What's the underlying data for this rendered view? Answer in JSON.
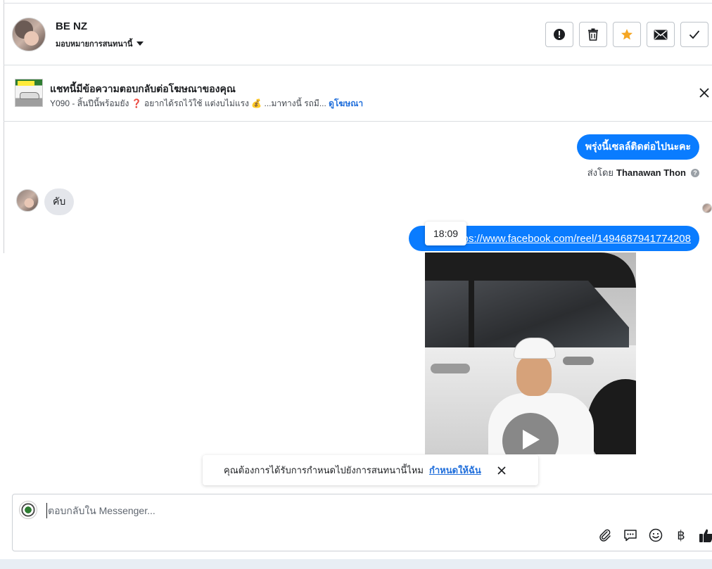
{
  "header": {
    "contact_name": "BE NZ",
    "assign_label": "มอบหมายการสนทนานี้",
    "actions": [
      {
        "icon": "alert-icon",
        "label": "Spam"
      },
      {
        "icon": "trash-icon",
        "label": "Delete"
      },
      {
        "icon": "star-icon",
        "label": "Star",
        "color": "#f5a623"
      },
      {
        "icon": "mail-icon",
        "label": "Mark unread"
      },
      {
        "icon": "check-icon",
        "label": "Done"
      }
    ]
  },
  "ad_banner": {
    "title": "แชทนี้มีข้อความตอบกลับต่อโฆษณาของคุณ",
    "subtitle": "Y090 - สิ้นปีนี้พร้อมยัง ❓ อยากได้รถไว้ใช้ แต่งบไม่แรง 💰 ...มาทางนี้ รถมื...",
    "link": "ดูโฆษณา"
  },
  "conversation": {
    "outgoing_1": "พรุ่งนี้เซลล์ติดต่อไปนะคะ",
    "sent_by_prefix": "ส่งโดย",
    "sent_by_name": "Thanawan Thon",
    "help_mark": "?",
    "incoming_1": "คับ",
    "outgoing_2_link": "https://www.facebook.com/reel/1494687941774208",
    "timestamp_tooltip": "18:09"
  },
  "schedule_prompt": {
    "text": "คุณต้องการได้รับการกำหนดไปยังการสนทนานี้ไหม",
    "link": "กำหนดให้ฉัน"
  },
  "composer": {
    "placeholder": "ตอบกลับใน Messenger...",
    "value": "",
    "baht_symbol": "฿"
  },
  "colors": {
    "bubble_out": "#0a7cff",
    "bubble_in": "#e4e6eb",
    "link": "#216fdb",
    "star": "#f5a623"
  }
}
